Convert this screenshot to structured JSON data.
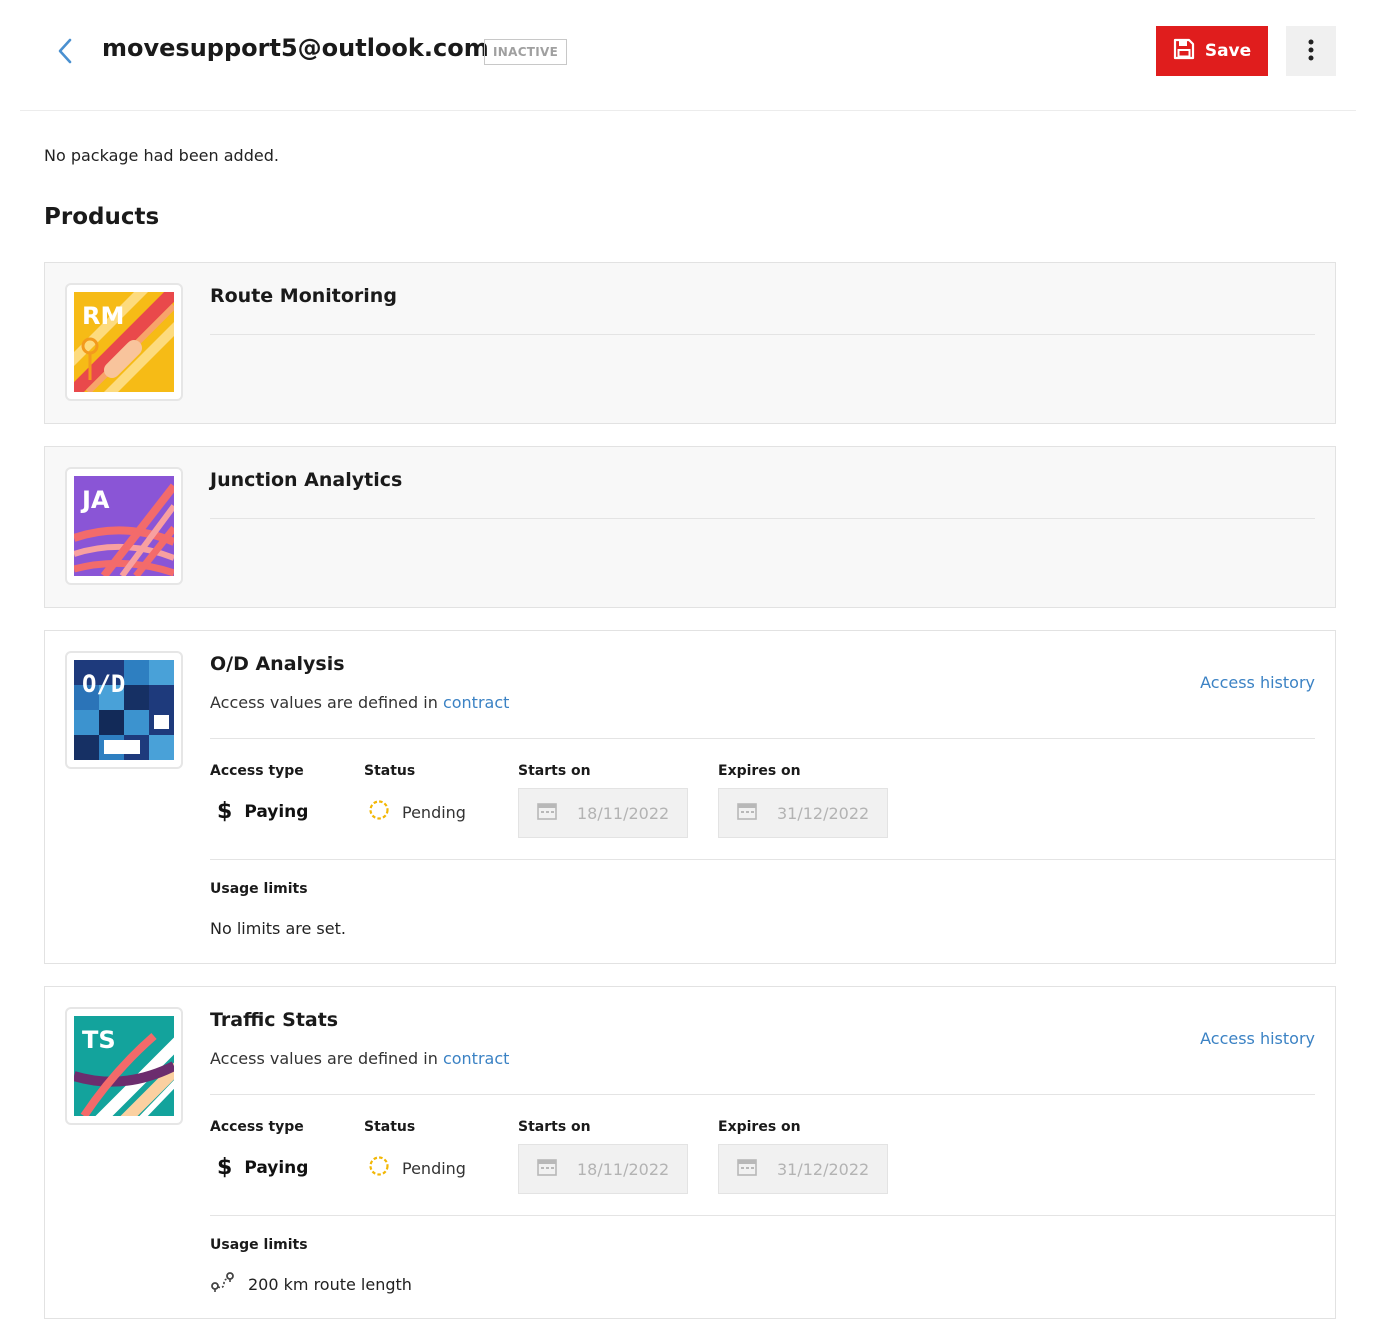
{
  "header": {
    "title": "movesupport5@outlook.com",
    "status_badge": "INACTIVE",
    "save_label": "Save"
  },
  "notice": "No package had been added.",
  "section_title": "Products",
  "labels": {
    "access_history": "Access history",
    "access_values_prefix": "Access values are defined in",
    "contract_link": "contract",
    "access_type": "Access type",
    "status": "Status",
    "starts_on": "Starts on",
    "expires_on": "Expires on",
    "usage_limits": "Usage limits"
  },
  "products": [
    {
      "name": "Route Monitoring",
      "logo_text": "RM",
      "expanded": false
    },
    {
      "name": "Junction Analytics",
      "logo_text": "JA",
      "expanded": false
    },
    {
      "name": "O/D Analysis",
      "logo_text": "O/D",
      "expanded": true,
      "access_type": "Paying",
      "status": "Pending",
      "starts_on": "18/11/2022",
      "expires_on": "31/12/2022",
      "usage": "No limits are set."
    },
    {
      "name": "Traffic Stats",
      "logo_text": "TS",
      "expanded": true,
      "access_type": "Paying",
      "status": "Pending",
      "starts_on": "18/11/2022",
      "expires_on": "31/12/2022",
      "usage": "200 km route length"
    }
  ],
  "colors": {
    "save_button": "#e01d1d",
    "link": "#3b82c4",
    "pending_spinner": "#f2b705"
  }
}
